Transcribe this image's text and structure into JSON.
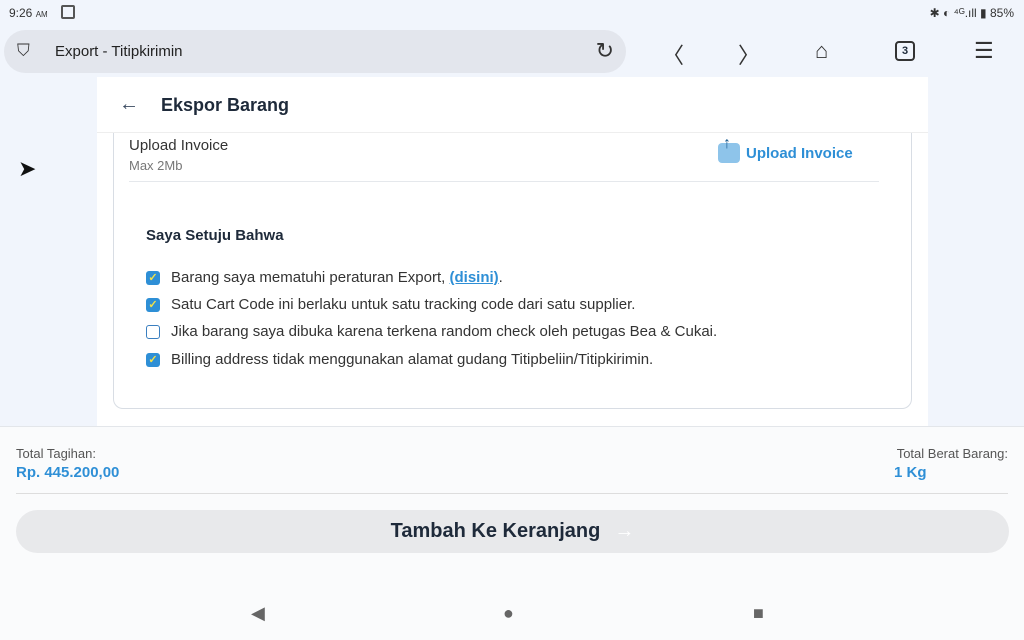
{
  "status": {
    "time": "9:26",
    "ampm": "AM",
    "right": "✱ ◐ ⁴ᴳ.ıll ▮ 85%"
  },
  "browser": {
    "tab_title": "Export - Titipkirimin",
    "tab_count": "3"
  },
  "header": {
    "title": "Ekspor Barang"
  },
  "upload": {
    "label": "Upload Invoice",
    "hint": "Max 2Mb",
    "button": "Upload Invoice"
  },
  "agreement": {
    "title": "Saya Setuju Bahwa",
    "items": [
      {
        "text": "Barang saya mematuhi peraturan Export, ",
        "link": "(disini)",
        "suffix": ".",
        "checked": true
      },
      {
        "text": "Satu Cart Code ini berlaku untuk satu tracking code dari satu supplier.",
        "checked": true
      },
      {
        "text": "Jika barang saya dibuka karena terkena random check oleh petugas Bea & Cukai.",
        "checked": false
      },
      {
        "text": "Billing address tidak menggunakan alamat gudang Titipbeliin/Titipkirimin.",
        "checked": true
      }
    ]
  },
  "footer": {
    "total_label": "Total Tagihan:",
    "total_value": "Rp. 445.200,00",
    "weight_label": "Total Berat Barang:",
    "weight_value": "1 Kg",
    "cta": "Tambah Ke Keranjang"
  },
  "colors": {
    "accent": "#2e8fd6"
  }
}
